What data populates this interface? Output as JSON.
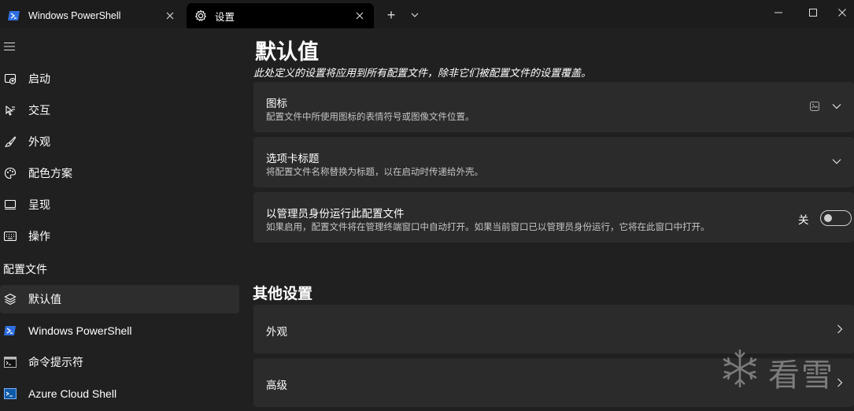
{
  "titlebar": {
    "tabs": [
      {
        "label": "Windows PowerShell",
        "icon": "powershell-icon"
      },
      {
        "label": "设置",
        "icon": "gear-icon"
      }
    ],
    "new_tab": "+"
  },
  "sidebar": {
    "items": [
      {
        "label": "启动",
        "icon": "startup-icon"
      },
      {
        "label": "交互",
        "icon": "interaction-icon"
      },
      {
        "label": "外观",
        "icon": "brush-icon"
      },
      {
        "label": "配色方案",
        "icon": "palette-icon"
      },
      {
        "label": "呈现",
        "icon": "monitor-icon"
      },
      {
        "label": "操作",
        "icon": "keyboard-icon"
      }
    ],
    "section_header": "配置文件",
    "profiles": [
      {
        "label": "默认值",
        "icon": "layers-icon",
        "selected": true
      },
      {
        "label": "Windows PowerShell",
        "icon": "powershell-icon"
      },
      {
        "label": "命令提示符",
        "icon": "cmd-icon"
      },
      {
        "label": "Azure Cloud Shell",
        "icon": "azure-cloud-icon"
      }
    ]
  },
  "main": {
    "title": "默认值",
    "subtitle": "此处定义的设置将应用到所有配置文件，除非它们被配置文件的设置覆盖。",
    "cards": [
      {
        "title": "图标",
        "desc": "配置文件中所使用图标的表情符号或图像文件位置。"
      },
      {
        "title": "选项卡标题",
        "desc": "将配置文件名称替换为标题，以在启动时传递给外壳。"
      },
      {
        "title": "以管理员身份运行此配置文件",
        "desc": "如果启用，配置文件将在管理终端窗口中自动打开。如果当前窗口已以管理员身份运行，它将在此窗口中打开。",
        "toggle_label": "关",
        "toggle_on": false
      }
    ],
    "other_title": "其他设置",
    "other_cards": [
      {
        "title": "外观"
      },
      {
        "title": "高级"
      }
    ]
  },
  "watermark": {
    "text": "看雪"
  },
  "colors": {
    "background": "#202020",
    "card": "#2b2b2b",
    "titlebar": "#1c1c1c",
    "active_tab": "#000000",
    "accent": "#3b78ff"
  }
}
